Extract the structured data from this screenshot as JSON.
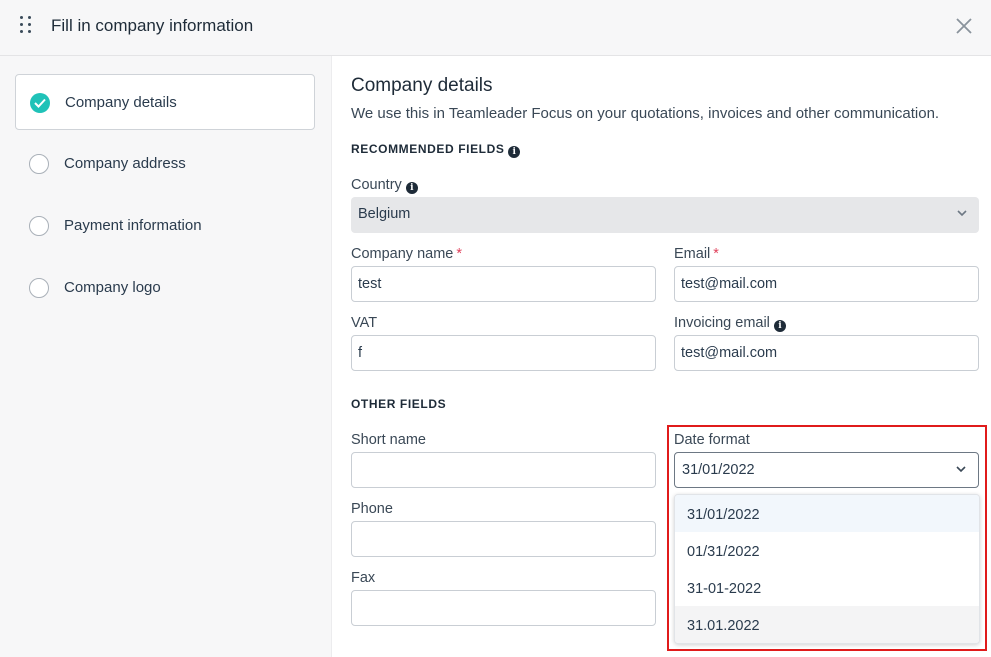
{
  "header": {
    "title": "Fill in company information"
  },
  "sidebar": {
    "steps": [
      {
        "label": "Company details",
        "state": "completed"
      },
      {
        "label": "Company address",
        "state": "pending"
      },
      {
        "label": "Payment information",
        "state": "pending"
      },
      {
        "label": "Company logo",
        "state": "pending"
      }
    ]
  },
  "main": {
    "title": "Company details",
    "description": "We use this in Teamleader Focus on your quotations, invoices and other communication.",
    "recommended_title": "RECOMMENDED FIELDS",
    "other_title": "OTHER FIELDS",
    "country": {
      "label": "Country",
      "value": "Belgium"
    },
    "company_name": {
      "label": "Company name",
      "required_mark": "*",
      "value": "test"
    },
    "email": {
      "label": "Email",
      "required_mark": "*",
      "value": "test@mail.com"
    },
    "vat": {
      "label": "VAT",
      "value": "f"
    },
    "invoicing_email": {
      "label": "Invoicing email",
      "value": "test@mail.com"
    },
    "short_name": {
      "label": "Short name",
      "value": ""
    },
    "phone": {
      "label": "Phone",
      "value": ""
    },
    "fax": {
      "label": "Fax",
      "value": ""
    },
    "date_format": {
      "label": "Date format",
      "value": "31/01/2022",
      "options": [
        "31/01/2022",
        "01/31/2022",
        "31-01-2022",
        "31.01.2022"
      ]
    }
  },
  "colors": {
    "accent": "#20c2b8",
    "highlight": "#e01b1b",
    "required": "#e0425c"
  },
  "icons": {
    "drag": "drag-handle-icon",
    "close": "close-icon",
    "check": "check-icon",
    "info": "info-icon",
    "chevron": "chevron-down-icon"
  }
}
